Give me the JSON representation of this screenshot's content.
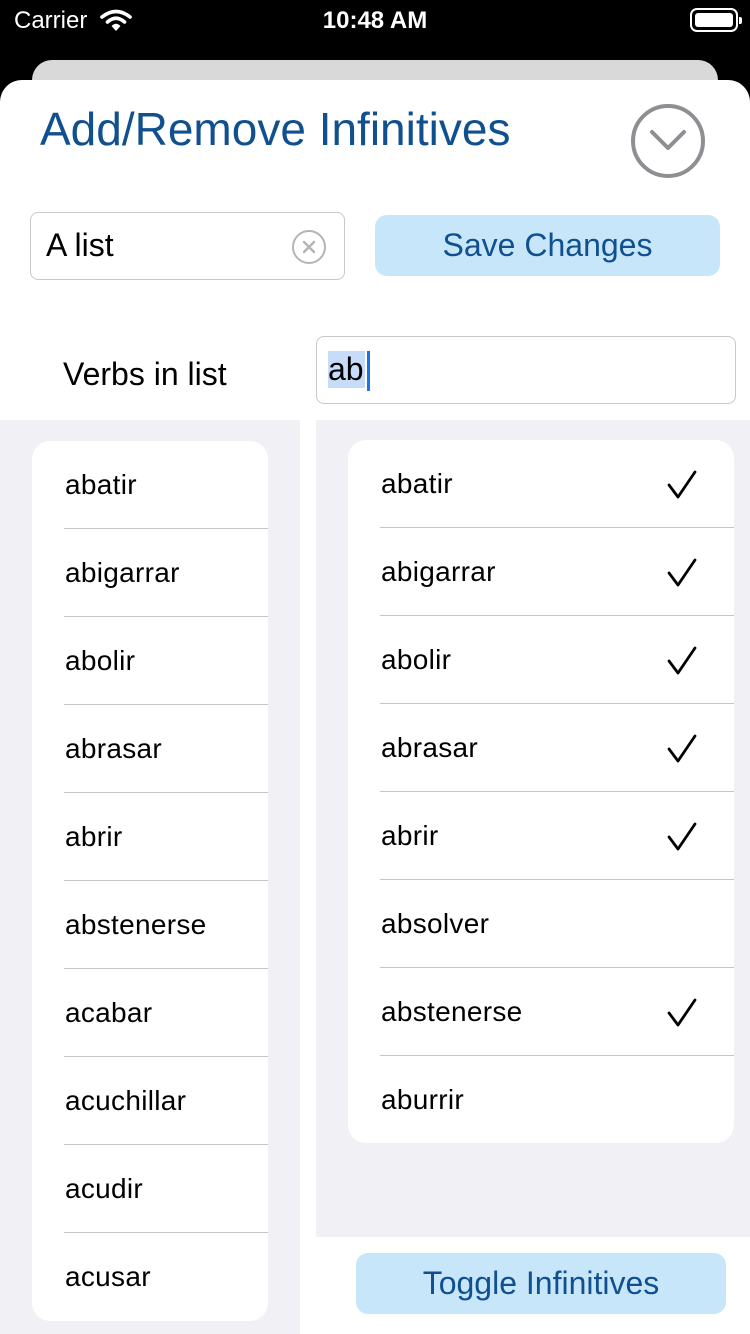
{
  "status_bar": {
    "carrier": "Carrier",
    "time": "10:48 AM"
  },
  "header": {
    "title": "Add/Remove Infinitives"
  },
  "list_name_field": {
    "value": "A list"
  },
  "save_button": {
    "label": "Save Changes"
  },
  "verbs_label": "Verbs in list",
  "search_field": {
    "value": "ab"
  },
  "verbs_in_list": [
    "abatir",
    "abigarrar",
    "abolir",
    "abrasar",
    "abrir",
    "abstenerse",
    "acabar",
    "acuchillar",
    "acudir",
    "acusar"
  ],
  "search_results": [
    {
      "label": "abatir",
      "checked": true
    },
    {
      "label": "abigarrar",
      "checked": true
    },
    {
      "label": "abolir",
      "checked": true
    },
    {
      "label": "abrasar",
      "checked": true
    },
    {
      "label": "abrir",
      "checked": true
    },
    {
      "label": "absolver",
      "checked": false
    },
    {
      "label": "abstenerse",
      "checked": true
    },
    {
      "label": "aburrir",
      "checked": false
    }
  ],
  "toggle_button": {
    "label": "Toggle Infinitives"
  },
  "colors": {
    "accent": "#11508e",
    "button_bg": "#c7e6fa",
    "list_bg": "#f0f0f5"
  }
}
